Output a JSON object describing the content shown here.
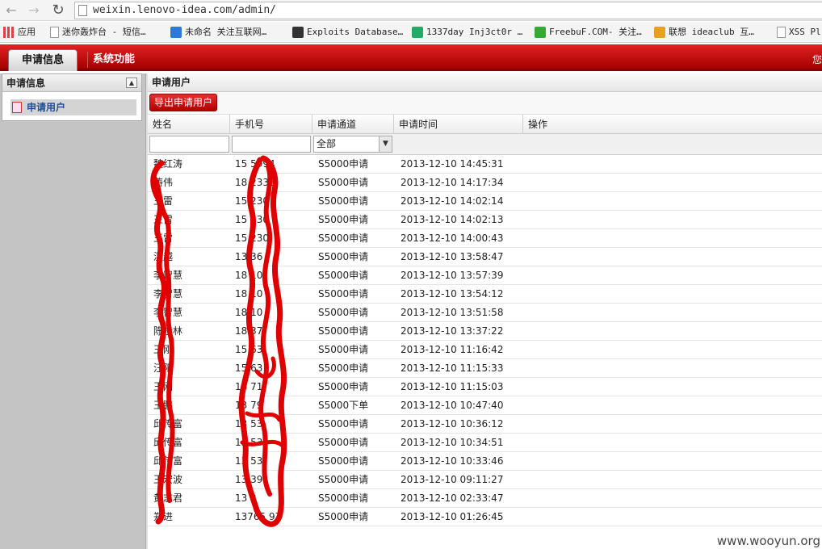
{
  "browser": {
    "url": "weixin.lenovo-idea.com/admin/",
    "bookmarks": [
      {
        "label": "应用",
        "icon": "apps-grid-icon",
        "color": "#d44"
      },
      {
        "label": "迷你轰炸台 - 短信…",
        "icon": "page-icon",
        "color": "#999"
      },
      {
        "label": "未命名 关注互联网…",
        "icon": "me-logo-icon",
        "color": "#2b7bd6"
      },
      {
        "label": "Exploits Database…",
        "icon": "exploit-db-icon",
        "color": "#333"
      },
      {
        "label": "1337day Inj3ct0r …",
        "icon": "1337day-icon",
        "color": "#2a6"
      },
      {
        "label": "FreebuF.COM- 关注…",
        "icon": "freebuf-icon",
        "color": "#3a3"
      },
      {
        "label": "联想 ideaclub 互…",
        "icon": "lenovo-idea-icon",
        "color": "#e7a11f"
      },
      {
        "label": "XSS Pl",
        "icon": "page-icon",
        "color": "#999"
      }
    ]
  },
  "header": {
    "tabs": [
      {
        "label": "申请信息",
        "active": true
      },
      {
        "label": "系统功能",
        "active": false
      }
    ],
    "right_text": "您"
  },
  "sidebar": {
    "title": "申请信息",
    "items": [
      {
        "label": "申请用户"
      }
    ]
  },
  "main": {
    "title": "申请用户",
    "export_button": "导出申请用户",
    "columns": [
      "姓名",
      "手机号",
      "申请通道",
      "申请时间",
      "操作"
    ],
    "channel_filter_value": "全部",
    "rows": [
      {
        "name": "魏红涛",
        "phone": "15   5994",
        "channel": "S5000申请",
        "time": "2013-12-10 14:45:31"
      },
      {
        "name": "涛伟",
        "phone": "18    2338",
        "channel": "S5000申请",
        "time": "2013-12-10 14:17:34"
      },
      {
        "name": "王雷",
        "phone": "15    230",
        "channel": "S5000申请",
        "time": "2013-12-10 14:02:14"
      },
      {
        "name": "王雷",
        "phone": "15    230",
        "channel": "S5000申请",
        "time": "2013-12-10 14:02:13"
      },
      {
        "name": "王雷",
        "phone": "15    230",
        "channel": "S5000申请",
        "time": "2013-12-10 14:00:43"
      },
      {
        "name": "温越",
        "phone": "13    36",
        "channel": "S5000申请",
        "time": "2013-12-10 13:58:47"
      },
      {
        "name": "李智慧",
        "phone": "18    10",
        "channel": "S5000申请",
        "time": "2013-12-10 13:57:39"
      },
      {
        "name": "李智慧",
        "phone": "18    10",
        "channel": "S5000申请",
        "time": "2013-12-10 13:54:12"
      },
      {
        "name": "李智慧",
        "phone": "18    10",
        "channel": "S5000申请",
        "time": "2013-12-10 13:51:58"
      },
      {
        "name": "陈桂林",
        "phone": "18    37",
        "channel": "S5000申请",
        "time": "2013-12-10 13:37:22"
      },
      {
        "name": "王刚",
        "phone": "15    63",
        "channel": "S5000申请",
        "time": "2013-12-10 11:16:42"
      },
      {
        "name": "汪阳",
        "phone": "15    63",
        "channel": "S5000申请",
        "time": "2013-12-10 11:15:33"
      },
      {
        "name": "王刚",
        "phone": "18    71",
        "channel": "S5000申请",
        "time": "2013-12-10 11:15:03"
      },
      {
        "name": "王鹏",
        "phone": "13    79",
        "channel": "S5000下单",
        "time": "2013-12-10 10:47:40"
      },
      {
        "name": "邱传富",
        "phone": "13    53",
        "channel": "S5000申请",
        "time": "2013-12-10 10:36:12"
      },
      {
        "name": "邱传富",
        "phone": "13    53",
        "channel": "S5000申请",
        "time": "2013-12-10 10:34:51"
      },
      {
        "name": "邱传富",
        "phone": "13    53",
        "channel": "S5000申请",
        "time": "2013-12-10 10:33:46"
      },
      {
        "name": "王宏波",
        "phone": "13    39",
        "channel": "S5000申请",
        "time": "2013-12-10 09:11:27"
      },
      {
        "name": "黄志君",
        "phone": "13    2",
        "channel": "S5000申请",
        "time": "2013-12-10 02:33:47"
      },
      {
        "name": "郑进",
        "phone": "13765   97",
        "channel": "S5000申请",
        "time": "2013-12-10 01:26:45"
      }
    ]
  },
  "watermark": "www.wooyun.org",
  "redaction_color": "#e00000"
}
